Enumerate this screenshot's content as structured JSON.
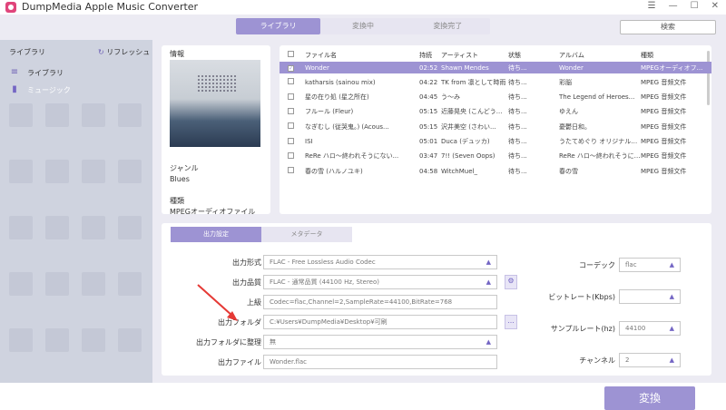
{
  "window": {
    "title": "DumpMedia Apple Music Converter",
    "controls": [
      "☰",
      "—",
      "☐",
      "✕"
    ]
  },
  "top_tabs": [
    {
      "label": "ライブラリ",
      "active": true
    },
    {
      "label": "変換中",
      "active": false
    },
    {
      "label": "変換完了",
      "active": false
    }
  ],
  "search_button": "検索",
  "sidebar": {
    "header": "ライブラリ",
    "refresh": "リフレッシュ",
    "items": [
      {
        "label": "ライブラリ",
        "icon": "library-icon",
        "active": false
      },
      {
        "label": "ミュージック",
        "icon": "music-icon",
        "active": true
      }
    ]
  },
  "info": {
    "header": "情報",
    "genre_label": "ジャンル",
    "genre_value": "Blues",
    "kind_label": "種類",
    "kind_value": "MPEGオーディオファイル"
  },
  "table": {
    "columns": [
      "ファイル名",
      "持続",
      "アーティスト",
      "状態",
      "アルバム",
      "種類"
    ],
    "rows": [
      {
        "checked": true,
        "name": "Wonder",
        "duration": "02:52",
        "artist": "Shawn Mendes",
        "status": "待ち...",
        "album": "Wonder",
        "type": "MPEGオーディオフ..."
      },
      {
        "checked": false,
        "name": "katharsis (sainou mix)",
        "duration": "04:22",
        "artist": "TK from 凛として時雨",
        "status": "待ち...",
        "album": "彩脳",
        "type": "MPEG 音频文件"
      },
      {
        "checked": false,
        "name": "星の在り処 (星之所在)",
        "duration": "04:45",
        "artist": "う～み",
        "status": "待ち...",
        "album": "The Legend of Heroes...",
        "type": "MPEG 音频文件"
      },
      {
        "checked": false,
        "name": "フルール (Fleur)",
        "duration": "05:15",
        "artist": "近藤晃央 (こんどう...",
        "status": "待ち...",
        "album": "ゆえん",
        "type": "MPEG 音频文件"
      },
      {
        "checked": false,
        "name": "なぎむし (従哭鬼。) (Acous...",
        "duration": "05:15",
        "artist": "沢井美空 (さわい...",
        "status": "待ち...",
        "album": "憂鬱日和。",
        "type": "MPEG 音频文件"
      },
      {
        "checked": false,
        "name": "ISI",
        "duration": "05:01",
        "artist": "Duca (デュッカ)",
        "status": "待ち...",
        "album": "うたてめぐり オリジナルサ...",
        "type": "MPEG 音频文件"
      },
      {
        "checked": false,
        "name": "ReRe ハロ～終われそうにない...",
        "duration": "03:47",
        "artist": "7!! (Seven Oops)",
        "status": "待ち...",
        "album": "ReRe ハロ～終われそうにな...",
        "type": "MPEG 音频文件"
      },
      {
        "checked": false,
        "name": "春の雪 (ハルノユキ)",
        "duration": "04:58",
        "artist": "WitchMuel_",
        "status": "待ち...",
        "album": "春の雪",
        "type": "MPEG 音频文件"
      }
    ]
  },
  "settings": {
    "tabs": [
      {
        "label": "出力設定",
        "active": true
      },
      {
        "label": "メタデータ",
        "active": false
      }
    ],
    "output_format": {
      "label": "出力形式",
      "value": "FLAC - Free Lossless Audio Codec"
    },
    "output_quality": {
      "label": "出力品質",
      "value": "FLAC - 通常品質 (44100 Hz, Stereo)"
    },
    "advanced": {
      "label": "上級",
      "value": "Codec=flac,Channel=2,SampleRate=44100,BitRate=768"
    },
    "output_folder": {
      "label": "出力フォルダ",
      "value": "C:¥Users¥DumpMedia¥Desktop¥可刷",
      "browse": "..."
    },
    "organize": {
      "label": "出力フォルダに整理",
      "value": "無"
    },
    "output_file": {
      "label": "出力ファイル",
      "value": "Wonder.flac"
    },
    "codec": {
      "label": "コーデック",
      "value": "flac"
    },
    "bitrate": {
      "label": "ビットレート(Kbps)",
      "value": ""
    },
    "samplerate": {
      "label": "サンプルレート(hz)",
      "value": "44100"
    },
    "channel": {
      "label": "チャンネル",
      "value": "2"
    }
  },
  "convert_button": "変換",
  "colors": {
    "accent": "#9d93d3",
    "sidebar": "#cfd3df",
    "arrow": "#e53935"
  }
}
